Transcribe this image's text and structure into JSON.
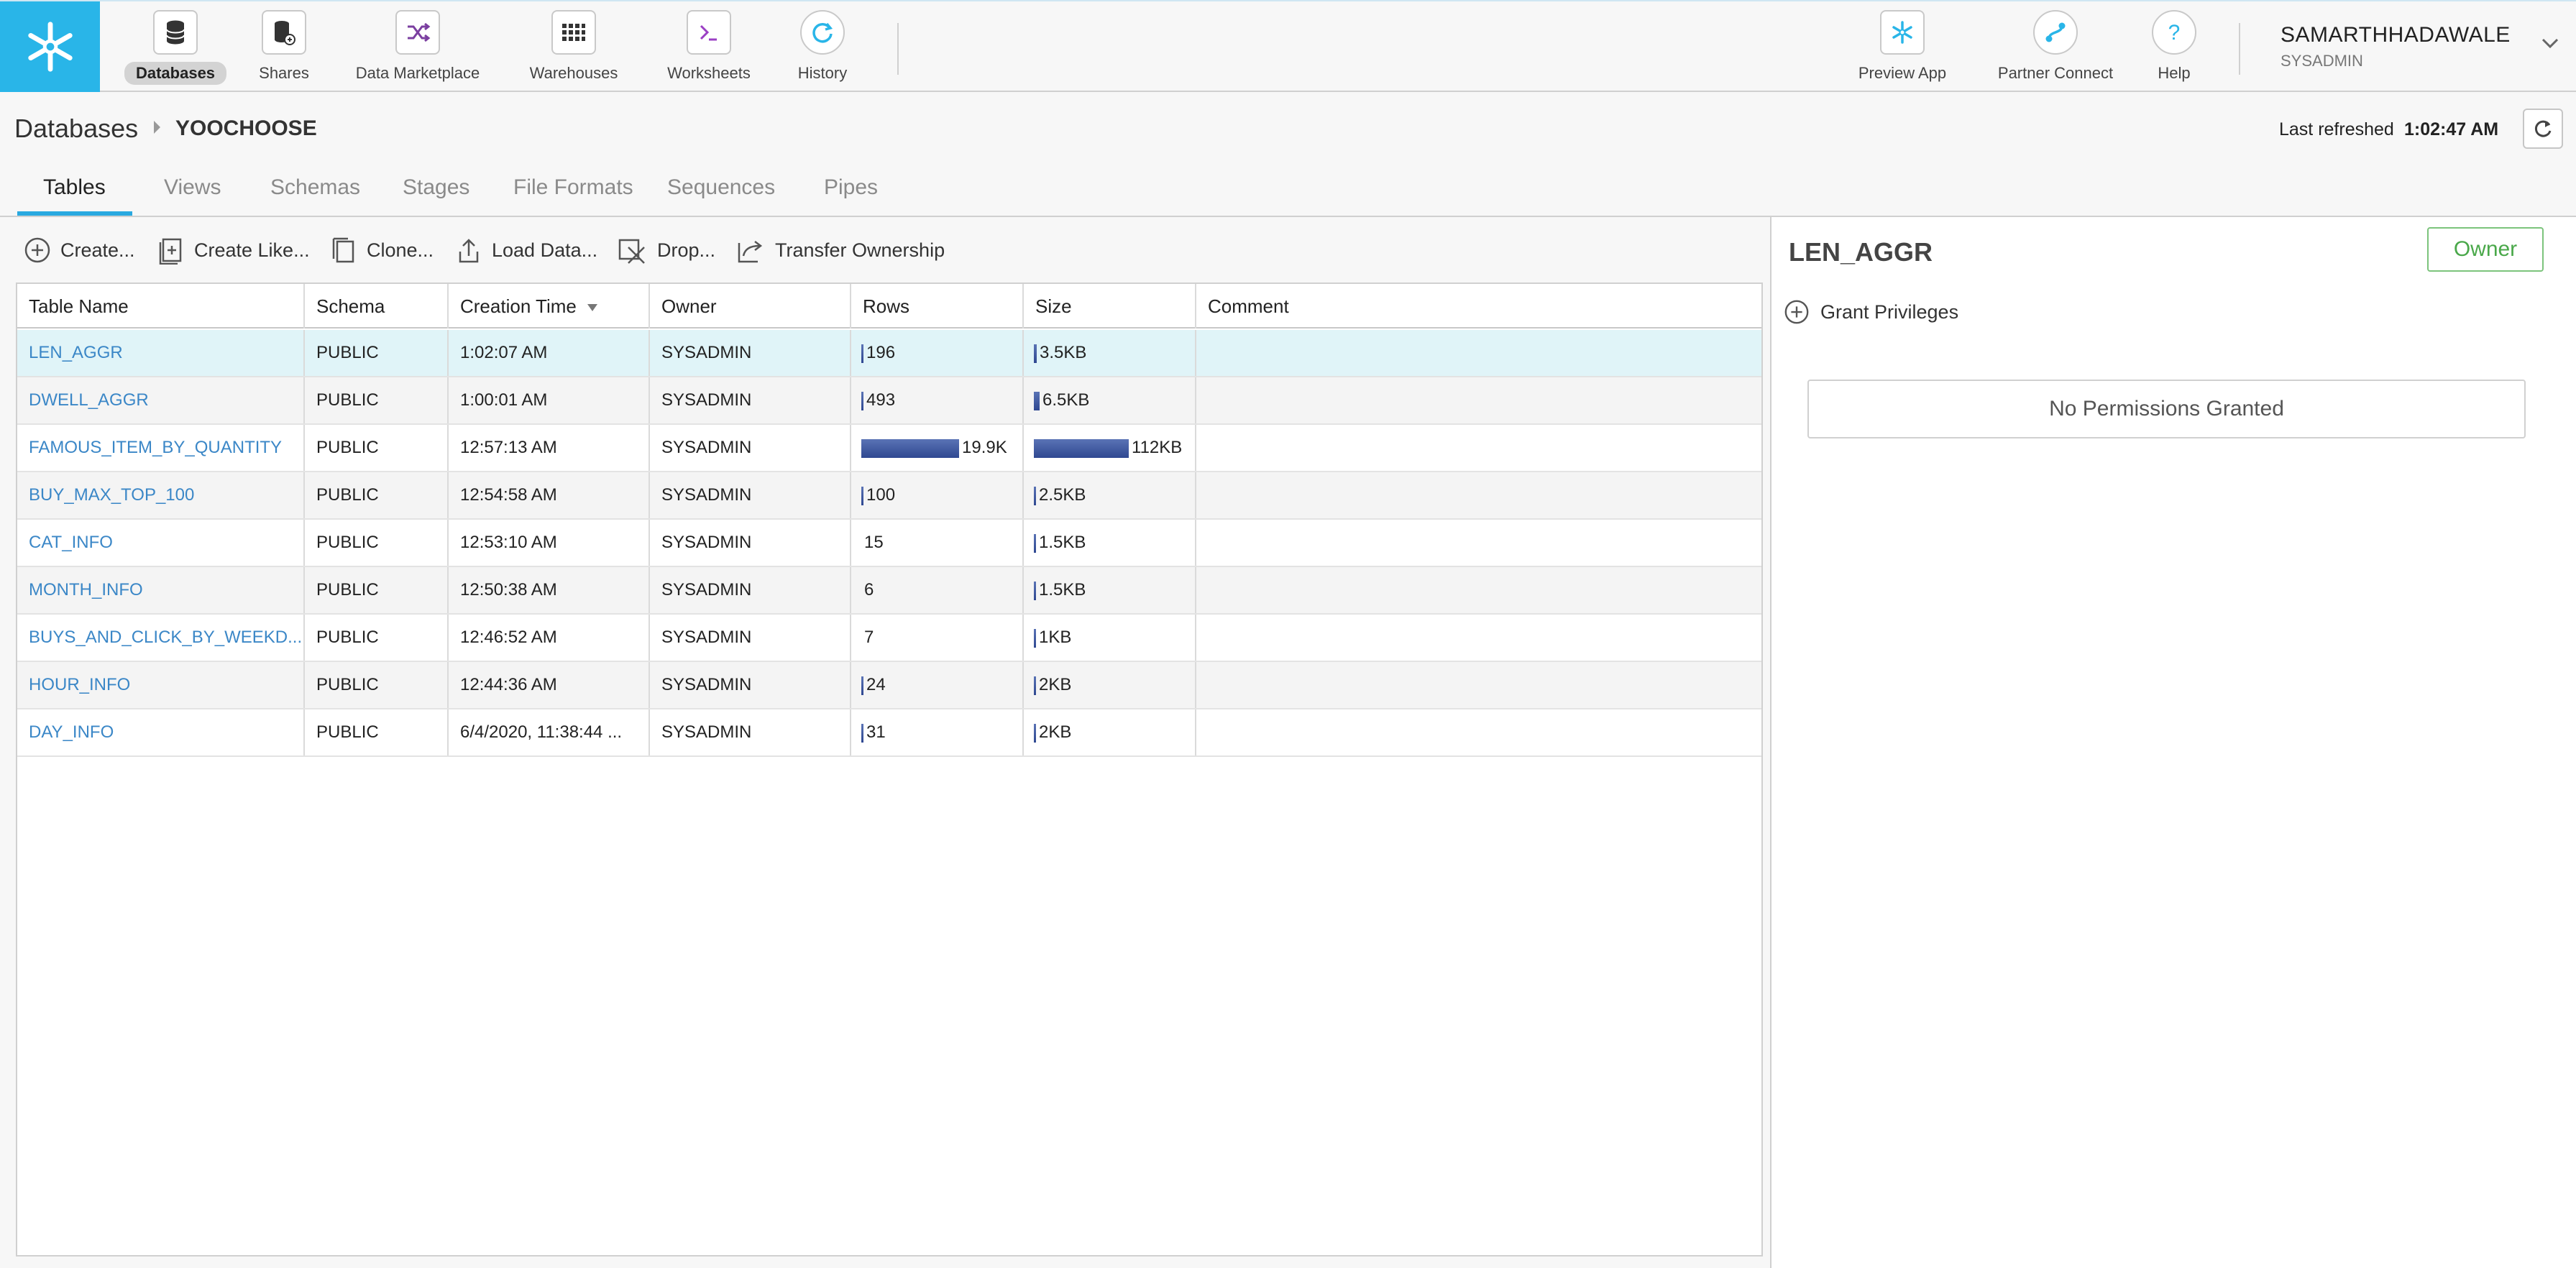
{
  "nav": {
    "items": [
      {
        "label": "Databases",
        "icon": "database-icon"
      },
      {
        "label": "Shares",
        "icon": "shares-icon"
      },
      {
        "label": "Data Marketplace",
        "icon": "marketplace-icon"
      },
      {
        "label": "Warehouses",
        "icon": "warehouse-grid-icon"
      },
      {
        "label": "Worksheets",
        "icon": "terminal-icon"
      },
      {
        "label": "History",
        "icon": "history-icon"
      }
    ],
    "right_items": [
      {
        "label": "Preview App",
        "icon": "snowflake-icon"
      },
      {
        "label": "Partner Connect",
        "icon": "partner-connect-icon"
      },
      {
        "label": "Help",
        "icon": "help-icon"
      }
    ]
  },
  "user": {
    "name": "SAMARTHHADAWALE",
    "role": "SYSADMIN"
  },
  "breadcrumb": {
    "root": "Databases",
    "current": "YOOCHOOSE"
  },
  "refresh": {
    "label": "Last refreshed",
    "time": "1:02:47 AM"
  },
  "tabs": [
    "Tables",
    "Views",
    "Schemas",
    "Stages",
    "File Formats",
    "Sequences",
    "Pipes"
  ],
  "toolbar": {
    "create": "Create...",
    "create_like": "Create Like...",
    "clone": "Clone...",
    "load_data": "Load Data...",
    "drop": "Drop...",
    "transfer": "Transfer Ownership"
  },
  "table": {
    "columns": [
      "Table Name",
      "Schema",
      "Creation Time",
      "Owner",
      "Rows",
      "Size",
      "Comment"
    ],
    "rows": [
      {
        "name": "LEN_AGGR",
        "schema": "PUBLIC",
        "created": "1:02:07 AM",
        "owner": "SYSADMIN",
        "rows": "196",
        "rows_frac": 0.01,
        "size": "3.5KB",
        "size_frac": 0.031,
        "comment": ""
      },
      {
        "name": "DWELL_AGGR",
        "schema": "PUBLIC",
        "created": "1:00:01 AM",
        "owner": "SYSADMIN",
        "rows": "493",
        "rows_frac": 0.025,
        "size": "6.5KB",
        "size_frac": 0.058,
        "comment": ""
      },
      {
        "name": "FAMOUS_ITEM_BY_QUANTITY",
        "schema": "PUBLIC",
        "created": "12:57:13 AM",
        "owner": "SYSADMIN",
        "rows": "19.9K",
        "rows_frac": 1.0,
        "size": "112KB",
        "size_frac": 1.0,
        "comment": ""
      },
      {
        "name": "BUY_MAX_TOP_100",
        "schema": "PUBLIC",
        "created": "12:54:58 AM",
        "owner": "SYSADMIN",
        "rows": "100",
        "rows_frac": 0.005,
        "size": "2.5KB",
        "size_frac": 0.022,
        "comment": ""
      },
      {
        "name": "CAT_INFO",
        "schema": "PUBLIC",
        "created": "12:53:10 AM",
        "owner": "SYSADMIN",
        "rows": "15",
        "rows_frac": 0.0,
        "size": "1.5KB",
        "size_frac": 0.013,
        "comment": ""
      },
      {
        "name": "MONTH_INFO",
        "schema": "PUBLIC",
        "created": "12:50:38 AM",
        "owner": "SYSADMIN",
        "rows": "6",
        "rows_frac": 0.0,
        "size": "1.5KB",
        "size_frac": 0.013,
        "comment": ""
      },
      {
        "name": "BUYS_AND_CLICK_BY_WEEKD...",
        "schema": "PUBLIC",
        "created": "12:46:52 AM",
        "owner": "SYSADMIN",
        "rows": "7",
        "rows_frac": 0.0,
        "size": "1KB",
        "size_frac": 0.009,
        "comment": ""
      },
      {
        "name": "HOUR_INFO",
        "schema": "PUBLIC",
        "created": "12:44:36 AM",
        "owner": "SYSADMIN",
        "rows": "24",
        "rows_frac": 0.001,
        "size": "2KB",
        "size_frac": 0.018,
        "comment": ""
      },
      {
        "name": "DAY_INFO",
        "schema": "PUBLIC",
        "created": "6/4/2020, 11:38:44 ...",
        "owner": "SYSADMIN",
        "rows": "31",
        "rows_frac": 0.002,
        "size": "2KB",
        "size_frac": 0.018,
        "comment": ""
      }
    ]
  },
  "detail": {
    "title": "LEN_AGGR",
    "owner_badge": "Owner",
    "grant": "Grant Privileges",
    "empty": "No Permissions Granted"
  },
  "colors": {
    "accent": "#29b5e8",
    "link": "#3b87c7",
    "bar": "#2f4891",
    "selected_row": "#e0f4f8",
    "owner_green": "#4aa84a"
  }
}
